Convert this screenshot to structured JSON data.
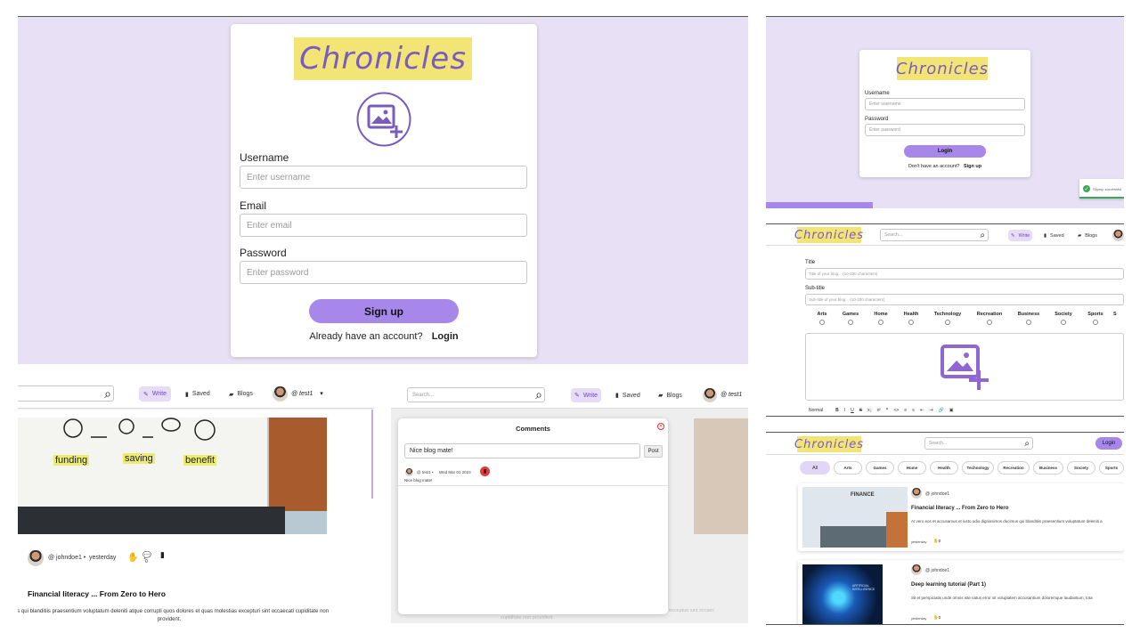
{
  "brand": {
    "logo_text": "Chronicles"
  },
  "signup": {
    "username_label": "Username",
    "username_placeholder": "Enter username",
    "email_label": "Email",
    "email_placeholder": "Enter email",
    "password_label": "Password",
    "password_placeholder": "Enter password",
    "submit_label": "Sign up",
    "footer_text": "Already have an account?",
    "footer_link": "Login"
  },
  "login": {
    "username_label": "Username",
    "username_placeholder": "Enter username",
    "password_label": "Password",
    "password_placeholder": "Enter password",
    "submit_label": "Login",
    "footer_text": "Don't have an account?",
    "footer_link": "Sign up",
    "toast": "Signup successful"
  },
  "nav": {
    "search_placeholder": "Search...",
    "write": "Write",
    "saved": "Saved",
    "blogs": "Blogs",
    "user": "@ test1",
    "login": "Login"
  },
  "editor": {
    "title_label": "Title",
    "title_placeholder": "Title of your blog... (10-200 characters)",
    "subtitle_label": "Sub-title",
    "subtitle_placeholder": "Sub-title of your blog... (10-200 characters)",
    "categories": [
      "Arts",
      "Games",
      "Home",
      "Health",
      "Technology",
      "Recreation",
      "Business",
      "Society",
      "Sports",
      "S"
    ],
    "toolbar_format": "Normal",
    "toolbar_buttons": [
      "B",
      "I",
      "U",
      "S",
      "x₂",
      "x²",
      "❞",
      "<>",
      "≡",
      "≡",
      "⇤",
      "⇥",
      "🔗",
      "▣"
    ]
  },
  "post": {
    "whiteboard_words": [
      "funding",
      "saving",
      "benefit"
    ],
    "author": "@ johndoe1 •",
    "time": "yesterday",
    "title": "Financial literacy ... From Zero to Hero",
    "body": "mus qui blanditiis praesentium voluptatum deleniti atque corrupti quos dolores et quas molestias excepturi sint occaecati cupiditate non provident."
  },
  "comments": {
    "title": "Comments",
    "input_value": "Nice blog mate!",
    "post_button": "Post",
    "items": [
      {
        "author": "@ test1 •",
        "date": "Wed Mar 01 2023",
        "text": "Nice blog mate!"
      }
    ],
    "count": "0",
    "background_text": "excepturi sint occaec",
    "background_text2": "cupiditate non provident."
  },
  "feed": {
    "filters": [
      "All",
      "Arts",
      "Games",
      "Home",
      "Health",
      "Technology",
      "Recreation",
      "Business",
      "Society",
      "Sports"
    ],
    "cards": [
      {
        "author": "@ johndoe1",
        "title": "Financial literacy ... From Zero to Hero",
        "excerpt": "At vero eos et accusamus et iusto odio dignissimos ducimus qui blanditiis praesentium voluptatum deleniti a",
        "time": "yesterday",
        "likes": "0",
        "image_text": "FINANCE"
      },
      {
        "author": "@ johndoe1",
        "title": "Deep learning tutorial (Part 1)",
        "excerpt": "Sit et perspiciatis unde omnis iste natus error sit voluptatem accusantium doloremque laudantium, tota",
        "time": "yesterday",
        "likes": "0",
        "image_text": "ARTIFICIAL INTELLIGENCE"
      }
    ]
  },
  "colors": {
    "lavender_bg": "#e8e0f5",
    "accent": "#a787ea",
    "logo_bg": "#f3e476",
    "logo_text": "#7a5bbf"
  }
}
